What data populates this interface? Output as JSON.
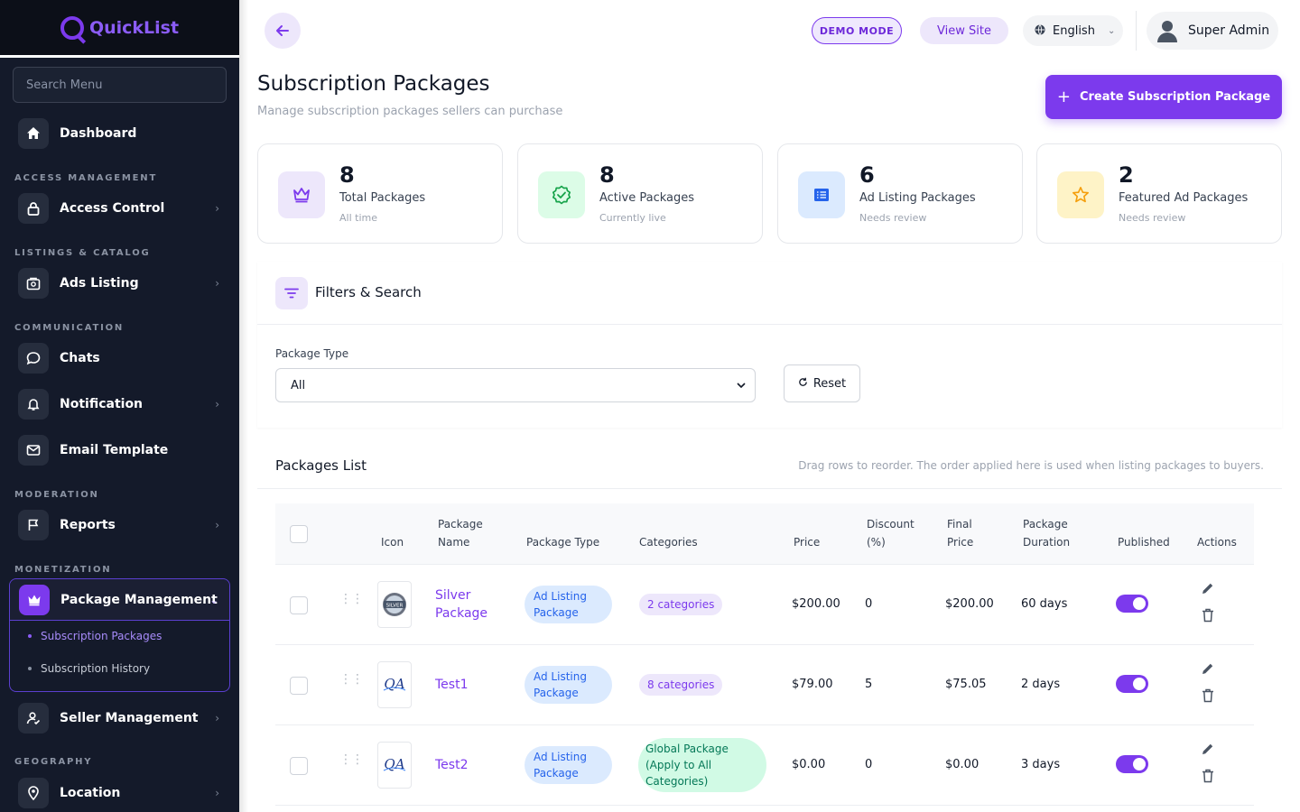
{
  "app": {
    "name": "QuickList"
  },
  "sidebar": {
    "search_placeholder": "Search Menu",
    "dashboard": "Dashboard",
    "sections": {
      "access": "ACCESS MANAGEMENT",
      "listings": "LISTINGS & CATALOG",
      "communication": "COMMUNICATION",
      "moderation": "MODERATION",
      "monetization": "MONETIZATION",
      "geography": "GEOGRAPHY"
    },
    "items": {
      "access_control": "Access Control",
      "ads_listing": "Ads Listing",
      "chats": "Chats",
      "notification": "Notification",
      "email_template": "Email Template",
      "reports": "Reports",
      "package_management": "Package Management",
      "subscription_packages": "Subscription Packages",
      "subscription_history": "Subscription History",
      "seller_management": "Seller Management",
      "location": "Location"
    }
  },
  "topbar": {
    "demo_mode": "DEMO MODE",
    "view_site": "View Site",
    "language": "English",
    "user": "Super Admin"
  },
  "page": {
    "title": "Subscription Packages",
    "subtitle": "Manage subscription packages sellers can purchase",
    "create_button": "Create Subscription Package"
  },
  "stats": [
    {
      "value": "8",
      "label": "Total Packages",
      "hint": "All time",
      "icon": "crown-icon",
      "color": "#7c3aed"
    },
    {
      "value": "8",
      "label": "Active Packages",
      "hint": "Currently live",
      "icon": "check-badge-icon",
      "color": "#16a34a"
    },
    {
      "value": "6",
      "label": "Ad Listing Packages",
      "hint": "Needs review",
      "icon": "list-icon",
      "color": "#2563eb"
    },
    {
      "value": "2",
      "label": "Featured Ad Packages",
      "hint": "Needs review",
      "icon": "star-icon",
      "color": "#f59e0b"
    }
  ],
  "filters": {
    "title": "Filters & Search",
    "package_type_label": "Package Type",
    "package_type_value": "All",
    "reset": "Reset"
  },
  "packages_list": {
    "title": "Packages List",
    "hint": "Drag rows to reorder. The order applied here is used when listing packages to buyers.",
    "columns": {
      "icon": "Icon",
      "name_1": "Package",
      "name_2": "Name",
      "type": "Package Type",
      "categories": "Categories",
      "price": "Price",
      "discount_1": "Discount",
      "discount_2": "(%)",
      "final_1": "Final",
      "final_2": "Price",
      "duration_1": "Package",
      "duration_2": "Duration",
      "published": "Published",
      "actions": "Actions"
    },
    "rows": [
      {
        "name_1": "Silver",
        "name_2": "Package",
        "type_1": "Ad Listing",
        "type_2": "Package",
        "categories": "2 categories",
        "price": "$200.00",
        "discount": "0",
        "final_price": "$200.00",
        "duration": "60 days",
        "published": true,
        "icon_text": "SILVER"
      },
      {
        "name_1": "Test1",
        "name_2": "",
        "type_1": "Ad Listing",
        "type_2": "Package",
        "categories": "8 categories",
        "price": "$79.00",
        "discount": "5",
        "final_price": "$75.05",
        "duration": "2 days",
        "published": true,
        "icon_text": "QA"
      },
      {
        "name_1": "Test2",
        "name_2": "",
        "type_1": "Ad Listing",
        "type_2": "Package",
        "categories_1": "Global Package",
        "categories_2": "(Apply to All",
        "categories_3": "Categories)",
        "price": "$0.00",
        "discount": "0",
        "final_price": "$0.00",
        "duration": "3 days",
        "published": true,
        "icon_text": "QA"
      }
    ]
  }
}
